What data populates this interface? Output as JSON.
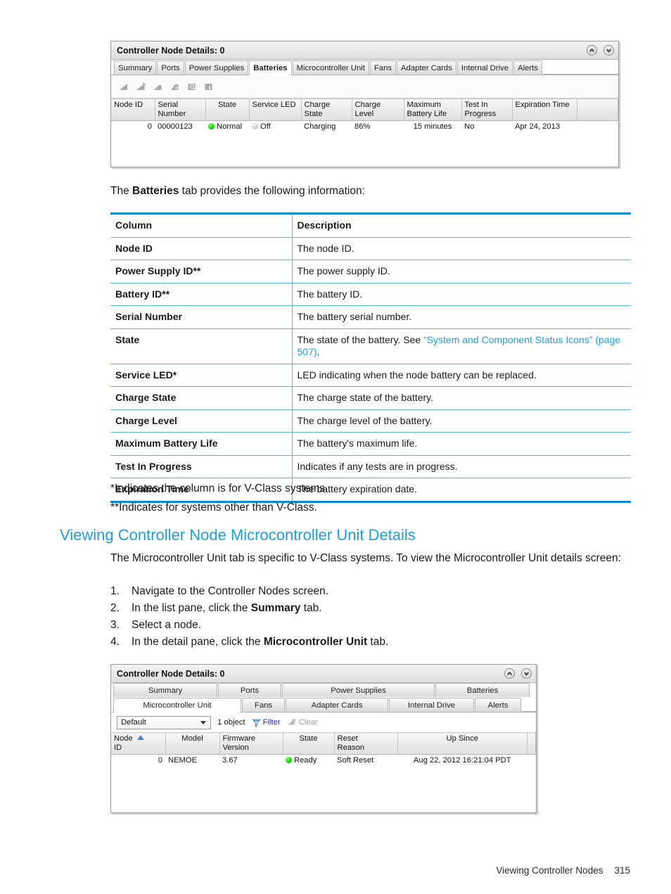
{
  "page": {
    "footer_section": "Viewing Controller Nodes",
    "footer_page_number": "315"
  },
  "screenshot_batteries": {
    "title": "Controller Node Details: 0",
    "collapse_icon": "chevron-up-circle-icon",
    "expand_icon": "chevron-down-circle-icon",
    "tabs": [
      {
        "label": "Summary",
        "active": false
      },
      {
        "label": "Ports",
        "active": false
      },
      {
        "label": "Power Supplies",
        "active": false
      },
      {
        "label": "Batteries",
        "active": true
      },
      {
        "label": "Microcontroller Unit",
        "active": false
      },
      {
        "label": "Fans",
        "active": false
      },
      {
        "label": "Adapter Cards",
        "active": false
      },
      {
        "label": "Internal Drive",
        "active": false
      },
      {
        "label": "Alerts",
        "active": false
      }
    ],
    "toolbar_icons": [
      "battery-icon-1",
      "battery-icon-2",
      "battery-icon-3",
      "battery-icon-4",
      "battery-icon-5",
      "battery-icon-6"
    ],
    "columns": [
      "Node ID",
      "Serial\nNumber",
      "State",
      "Service LED",
      "Charge\nState",
      "Charge Level",
      "Maximum\nBattery Life",
      "Test In\nProgress",
      "Expiration Time",
      ""
    ],
    "rows": [
      {
        "node_id": "0",
        "serial_number": "00000123",
        "state": "Normal",
        "state_led": "green",
        "service_led": "Off",
        "service_led_color": "gray",
        "charge_state": "Charging",
        "charge_level": "86%",
        "maximum_battery_life": "15 minutes",
        "test_in_progress": "No",
        "expiration_time": "Apr 24, 2013"
      }
    ]
  },
  "intro_text": {
    "before": "The ",
    "bold": "Batteries",
    "after": " tab provides the following information:"
  },
  "desc_table": {
    "headers": [
      "Column",
      "Description"
    ],
    "rows": [
      {
        "column": "Node ID",
        "description": "The node ID.",
        "link": null,
        "link_tail": null
      },
      {
        "column": "Power Supply ID**",
        "description": "The power supply ID.",
        "link": null,
        "link_tail": null
      },
      {
        "column": "Battery ID**",
        "description": "The battery ID.",
        "link": null,
        "link_tail": null
      },
      {
        "column": "Serial Number",
        "description": "The battery serial number.",
        "link": null,
        "link_tail": null
      },
      {
        "column": "State",
        "description": "The state of the battery. See ",
        "link": "“System and Component Status Icons” (page 507)",
        "link_tail": "."
      },
      {
        "column": "Service LED*",
        "description": "LED indicating when the node battery can be replaced.",
        "link": null,
        "link_tail": null
      },
      {
        "column": "Charge State",
        "description": "The charge state of the battery.",
        "link": null,
        "link_tail": null
      },
      {
        "column": "Charge Level",
        "description": "The charge level of the battery.",
        "link": null,
        "link_tail": null
      },
      {
        "column": "Maximum Battery Life",
        "description": "The battery's maximum life.",
        "link": null,
        "link_tail": null
      },
      {
        "column": "Test In Progress",
        "description": "Indicates if any tests are in progress.",
        "link": null,
        "link_tail": null
      },
      {
        "column": "Expiration Time",
        "description": "The battery expiration date.",
        "link": null,
        "link_tail": null
      }
    ]
  },
  "footnotes": {
    "single_star": "*Indicates the column is for V-Class systems.",
    "double_star": "**Indicates for systems other than V-Class."
  },
  "section": {
    "heading": "Viewing Controller Node Microcontroller Unit Details",
    "paragraph": "The Microcontroller Unit tab is specific to V-Class systems. To view the Microcontroller Unit details screen:",
    "steps": [
      {
        "n": "1.",
        "before": "Navigate to the Controller Nodes screen.",
        "bold": "",
        "after": ""
      },
      {
        "n": "2.",
        "before": "In the list pane, click the ",
        "bold": "Summary",
        "after": " tab."
      },
      {
        "n": "3.",
        "before": "Select a node.",
        "bold": "",
        "after": ""
      },
      {
        "n": "4.",
        "before": "In the detail pane, click the ",
        "bold": "Microcontroller Unit",
        "after": " tab."
      }
    ]
  },
  "screenshot_mcu": {
    "title": "Controller Node Details: 0",
    "collapse_icon": "chevron-up-circle-icon",
    "expand_icon": "chevron-down-circle-icon",
    "tabs_row1": [
      {
        "label": "Summary",
        "active": false
      },
      {
        "label": "Ports",
        "active": false
      },
      {
        "label": "Power Supplies",
        "active": false
      },
      {
        "label": "Batteries",
        "active": false
      }
    ],
    "tabs_row2": [
      {
        "label": "Microcontroller Unit",
        "active": true
      },
      {
        "label": "Fans",
        "active": false
      },
      {
        "label": "Adapter Cards",
        "active": false
      },
      {
        "label": "Internal Drive",
        "active": false
      },
      {
        "label": "Alerts",
        "active": false
      }
    ],
    "filterbar": {
      "view_select_value": "Default",
      "object_count": "1 object",
      "filter_label": "Filter",
      "filter_icon": "funnel-icon",
      "clear_label": "Clear",
      "clear_icon": "clear-filter-icon",
      "clear_disabled": true
    },
    "columns": [
      "Node\nID",
      "Model",
      "Firmware\nVersion",
      "State",
      "Reset\nReason",
      "Up Since",
      ""
    ],
    "sort_column": "Node ID",
    "sort_direction": "ascending",
    "rows": [
      {
        "node_id": "0",
        "model": "NEMOE",
        "firmware_version": "3.67",
        "state": "Ready",
        "state_led": "green",
        "reset_reason": "Soft Reset",
        "up_since": "Aug 22, 2012 16:21:04 PDT"
      }
    ]
  },
  "colors": {
    "accent_blue": "#0a8cc9",
    "link_blue": "#1f9fd8",
    "rule_blue": "#56b9e8",
    "status_green": "#12d400"
  }
}
